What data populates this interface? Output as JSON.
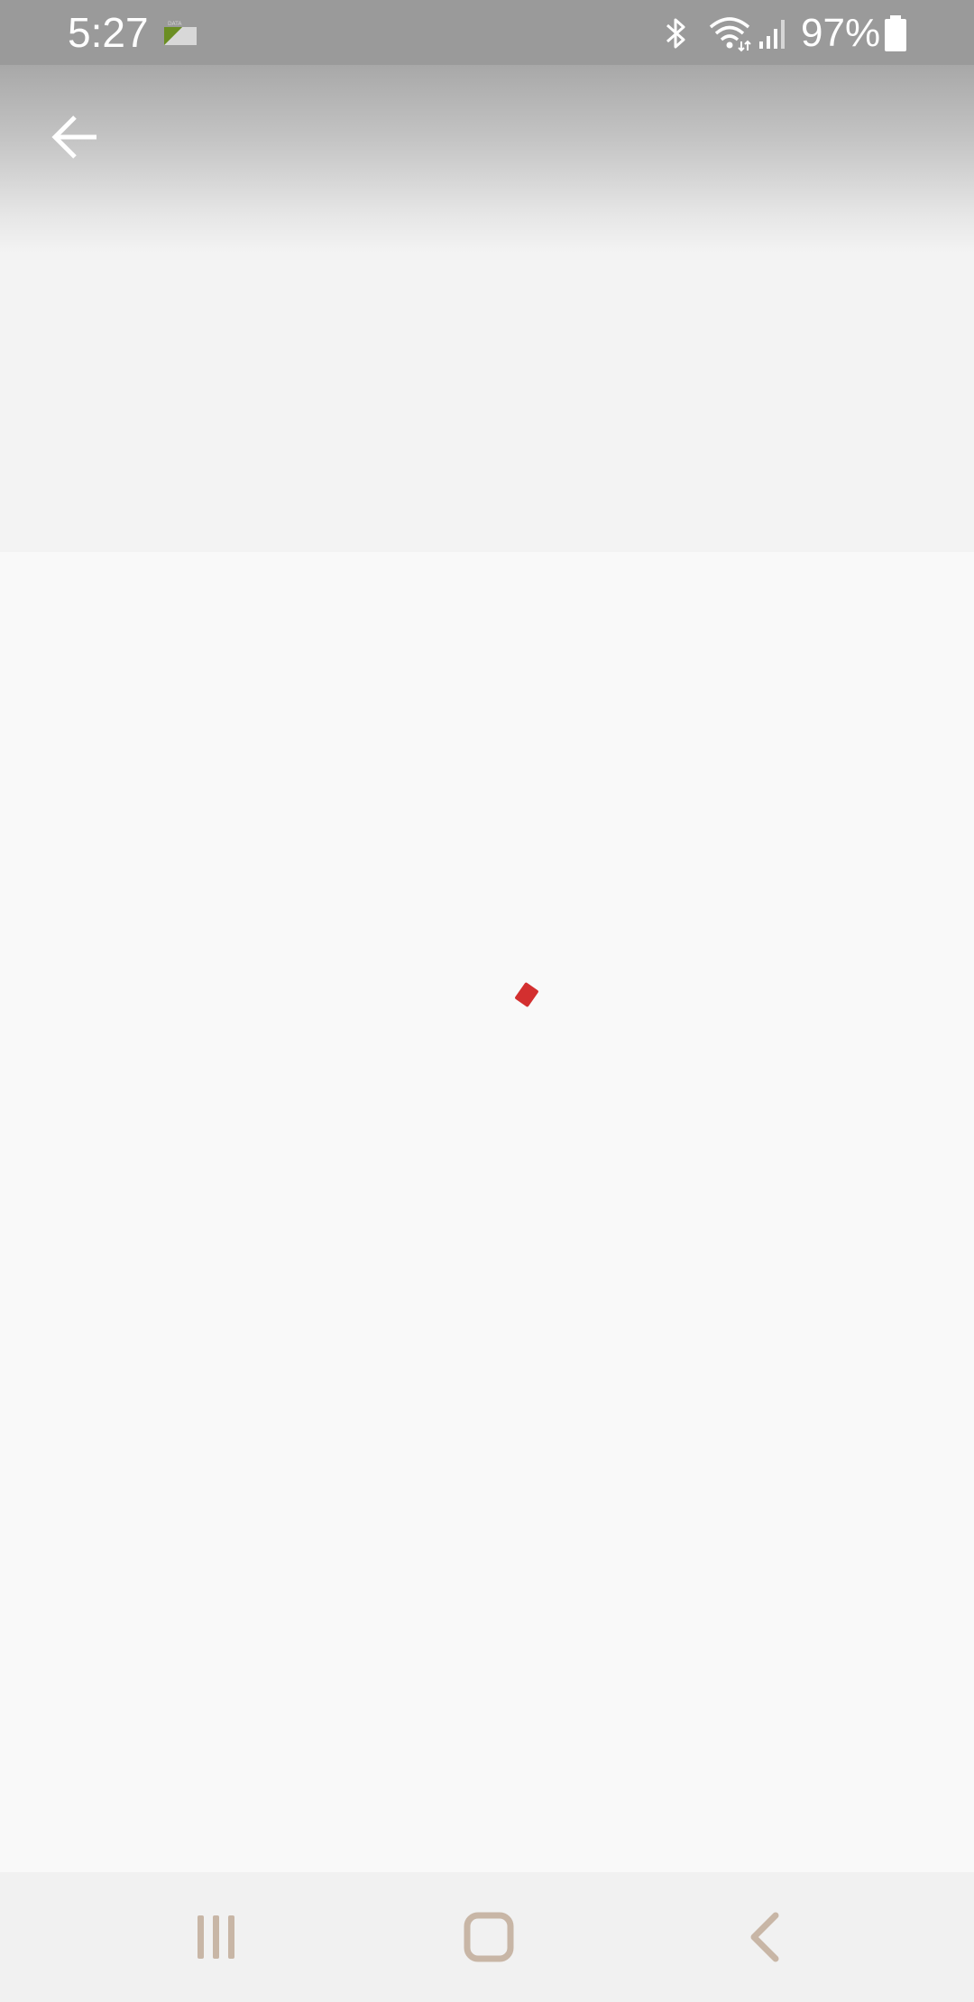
{
  "status_bar": {
    "time": "5:27",
    "battery": "97%",
    "icons": [
      "data-saver-icon",
      "bluetooth-icon",
      "wifi-icon",
      "signal-icon",
      "battery-icon"
    ]
  },
  "header": {
    "back_icon": "arrow-left-icon"
  },
  "content": {
    "loading_indicator_color": "#d32f2f"
  },
  "nav_bar": {
    "icons": [
      "recents-icon",
      "home-icon",
      "back-icon"
    ]
  },
  "colors": {
    "status_bar": "#9a9a9a",
    "header_top": "#a8a8a8",
    "background": "#f9f9f9",
    "nav_bar": "#f1f1f1",
    "nav_icon": "#c8b6a6"
  }
}
